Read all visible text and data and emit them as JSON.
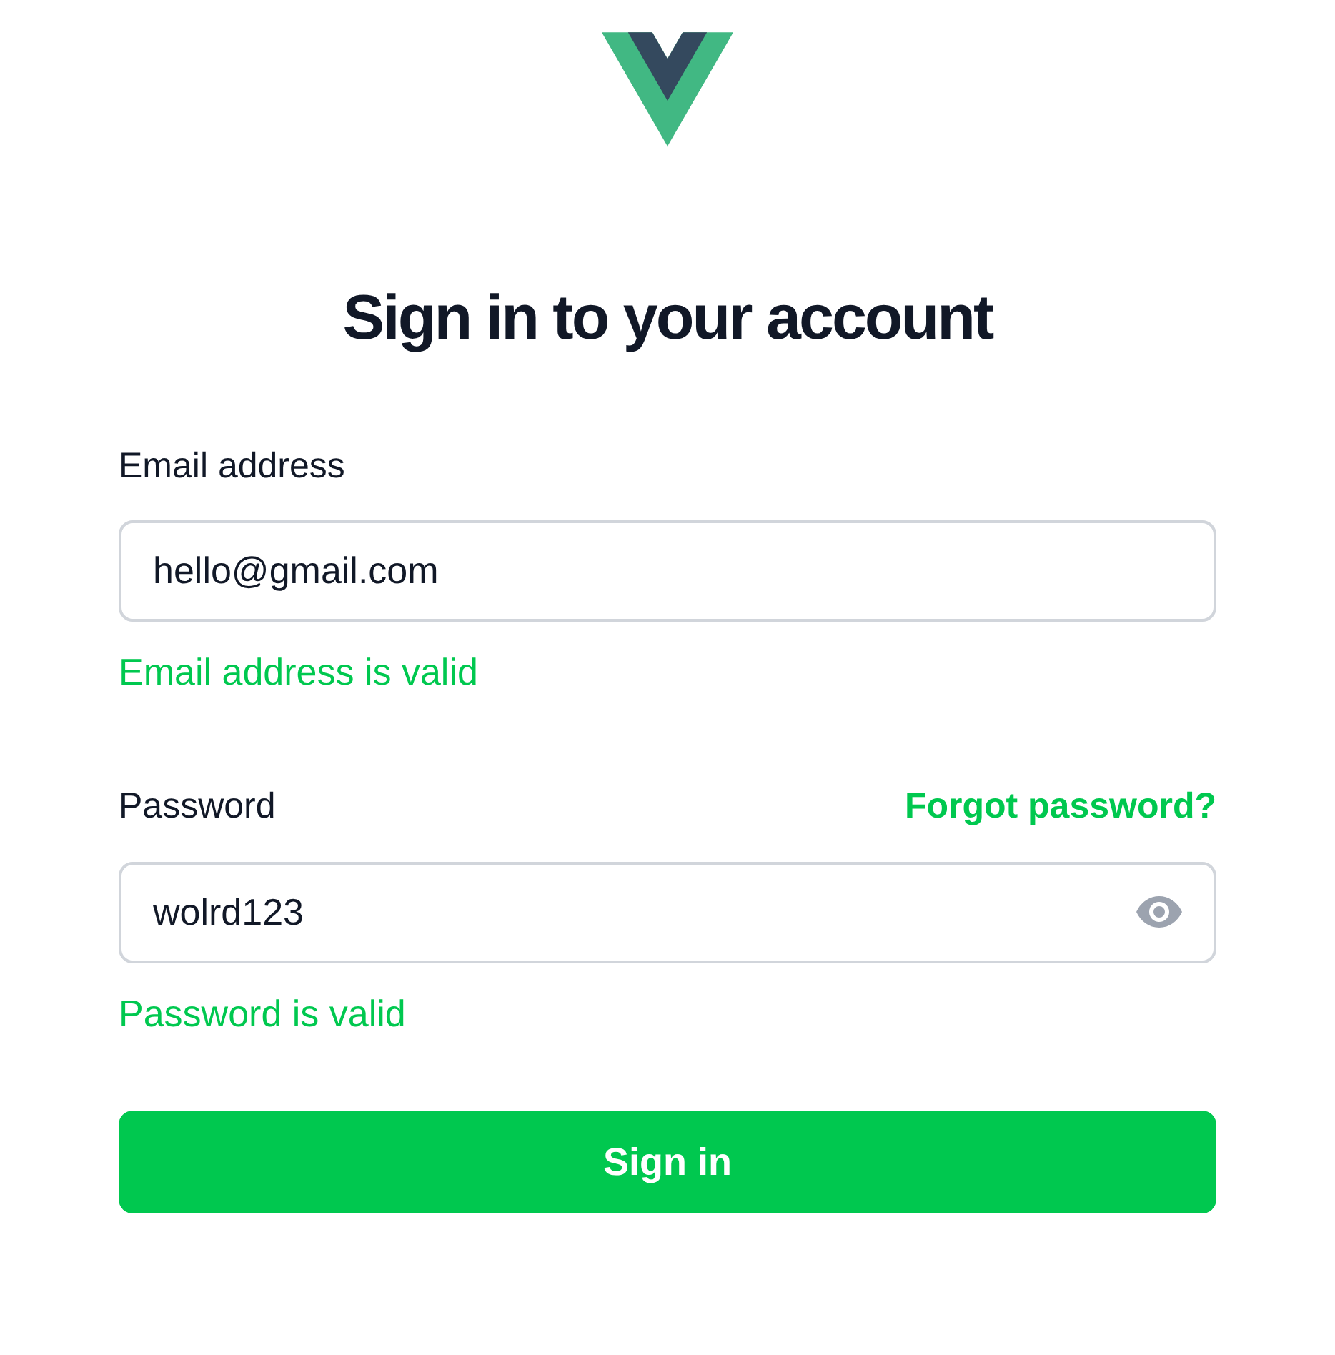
{
  "heading": "Sign in to your account",
  "fields": [
    {
      "kind": "email",
      "label": "Email address",
      "value": "hello@gmail.com",
      "message": "Email address is valid",
      "valid": true
    },
    {
      "kind": "password",
      "label": "Password",
      "link": "Forgot password?",
      "value": "wolrd123",
      "message": "Password is valid",
      "valid": true
    }
  ],
  "button": "Sign in"
}
